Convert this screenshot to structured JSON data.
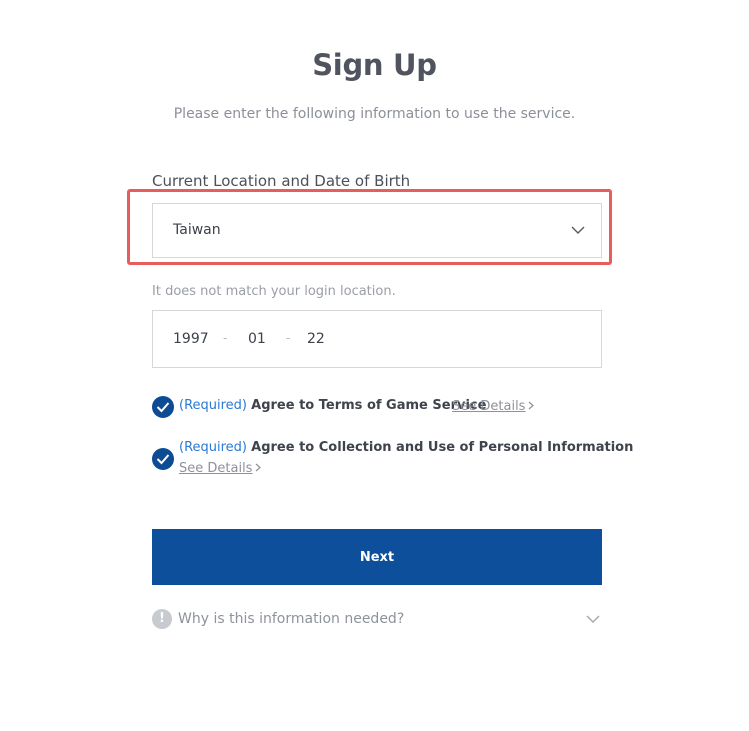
{
  "header": {
    "title": "Sign Up",
    "subtitle": "Please enter the following information to use the service."
  },
  "location_section": {
    "label": "Current Location and Date of Birth",
    "country_selected": "Taiwan",
    "mismatch_notice": "It does not match your login location."
  },
  "dob": {
    "year": "1997",
    "month": "01",
    "day": "22",
    "separator": "-"
  },
  "terms": [
    {
      "required_label": "(Required)",
      "text": "Agree to Terms of Game Service",
      "details_label": "See Details",
      "checked": true
    },
    {
      "required_label": "(Required)",
      "text": "Agree to Collection and Use of Personal Information",
      "details_label": "See Details",
      "checked": true
    }
  ],
  "actions": {
    "next_label": "Next"
  },
  "info": {
    "icon_text": "!",
    "why_label": "Why is this information needed?"
  },
  "colors": {
    "primary": "#0d4f9b",
    "required_link": "#2a7ad6",
    "highlight_border": "#e85c5c",
    "check_bg": "#0d4b94"
  },
  "icons": {
    "select_chevron": "chevron-down-icon",
    "check": "check-icon",
    "details_chevron": "chevron-right-icon",
    "info": "info-icon",
    "why_chevron": "chevron-down-icon"
  }
}
